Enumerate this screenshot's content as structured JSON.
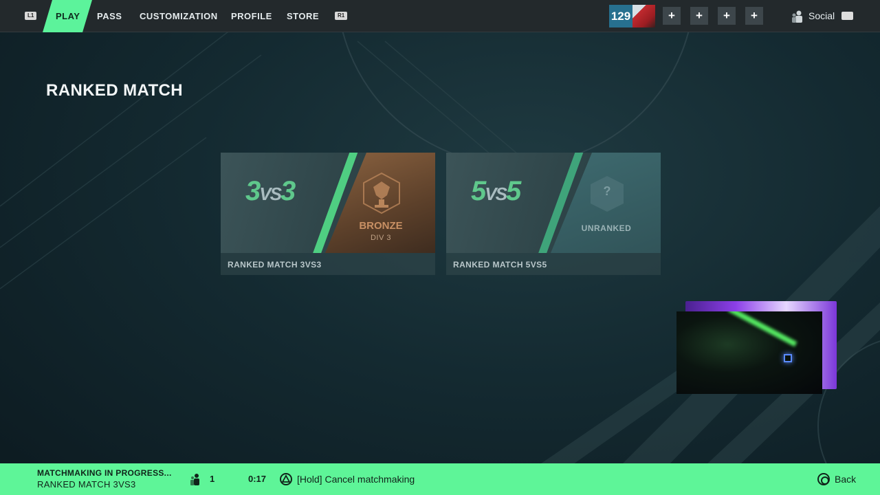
{
  "topbar": {
    "left_hint": "L1",
    "right_hint": "R1",
    "tabs": [
      {
        "label": "PLAY",
        "active": true
      },
      {
        "label": "PASS",
        "active": false
      },
      {
        "label": "CUSTOMIZATION",
        "active": false
      },
      {
        "label": "PROFILE",
        "active": false
      },
      {
        "label": "STORE",
        "active": false
      }
    ],
    "player_level": "129",
    "party_slots": [
      "+",
      "+",
      "+",
      "+"
    ],
    "social_label": "Social"
  },
  "page": {
    "title": "RANKED MATCH"
  },
  "modes": [
    {
      "vs_left": "3",
      "vs_mid": "VS",
      "vs_right": "3",
      "rank": "BRONZE",
      "division": "DIV 3",
      "label": "RANKED MATCH 3VS3"
    },
    {
      "vs_left": "5",
      "vs_mid": "VS",
      "vs_right": "5",
      "rank": "UNRANKED",
      "rank_symbol": "?",
      "label": "RANKED MATCH 5VS5"
    }
  ],
  "bottombar": {
    "status": "MATCHMAKING IN PROGRESS...",
    "mode": "RANKED MATCH 3VS3",
    "party_count": "1",
    "timer": "0:17",
    "cancel_label": "[Hold] Cancel matchmaking",
    "back_label": "Back"
  },
  "colors": {
    "accent": "#5ef598",
    "topbar": "#23292c",
    "bronze": "#7a5a3c"
  }
}
